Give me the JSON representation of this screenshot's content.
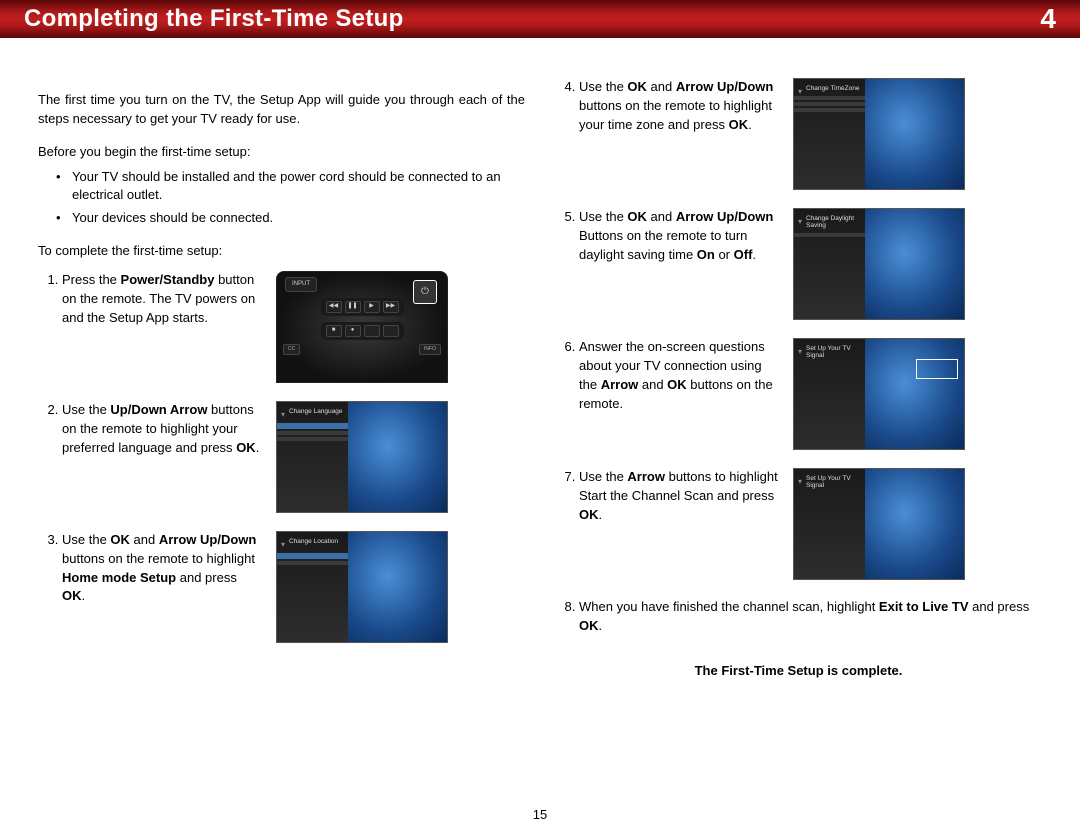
{
  "header": {
    "title": "Completing the First-Time Setup",
    "chapter": "4"
  },
  "intro": {
    "p1_a": "The first time you turn on the TV, the Setup App will guide you through each of the steps necessary to get your TV ready for use.",
    "p2": "Before you begin the first-time setup:",
    "bullet1": "Your TV should be installed and the power cord should be connected to an electrical outlet.",
    "bullet2": "Your devices should be connected.",
    "p3": "To complete the first-time setup:"
  },
  "steps_left": {
    "s1_a": "Press the ",
    "s1_b": "Power/Standby",
    "s1_c": " button on the remote. The TV powers on and the Setup App starts.",
    "s2_a": "Use the ",
    "s2_b": "Up/Down Arrow",
    "s2_c": " buttons on the remote to highlight your preferred language and press ",
    "s2_d": "OK",
    "s2_e": ".",
    "s3_a": "Use the ",
    "s3_b": "OK",
    "s3_c": " and ",
    "s3_d": "Arrow Up/Down",
    "s3_e": " buttons on the remote to highlight ",
    "s3_f": "Home mode Setup",
    "s3_g": " and press ",
    "s3_h": "OK",
    "s3_i": "."
  },
  "steps_right": {
    "s4_a": "Use the ",
    "s4_b": "OK",
    "s4_c": " and ",
    "s4_d": "Arrow Up/Down",
    "s4_e": " buttons on the remote to highlight your time zone and press ",
    "s4_f": "OK",
    "s4_g": ".",
    "s5_a": "Use the ",
    "s5_b": "OK",
    "s5_c": " and ",
    "s5_d": "Arrow Up/Down",
    "s5_e": " Buttons on the remote to turn daylight saving time ",
    "s5_f": "On",
    "s5_g": " or ",
    "s5_h": "Off",
    "s5_i": ".",
    "s6_a": "Answer the on-screen questions about your TV connection using the ",
    "s6_b": "Arrow",
    "s6_c": " and ",
    "s6_d": "OK",
    "s6_e": " buttons on the remote.",
    "s7_a": "Use the ",
    "s7_b": "Arrow",
    "s7_c": " buttons to highlight Start the Channel Scan and press ",
    "s7_d": "OK",
    "s7_e": ".",
    "s8_a": "When you have finished the channel scan, highlight ",
    "s8_b": "Exit to Live TV",
    "s8_c": " and press ",
    "s8_d": "OK",
    "s8_e": "."
  },
  "complete": "The First-Time Setup is complete.",
  "page_number": "15",
  "remote": {
    "input": "INPUT",
    "cc": "CC",
    "info": "INFO",
    "power": "⏻",
    "rew": "◀◀",
    "play": "▶",
    "pause": "❚❚",
    "ff": "▶▶"
  },
  "tv": {
    "lang_t": "Change Language",
    "loc_t": "Change Location",
    "tz_t": "Change TimeZone",
    "dst_t": "Change Daylight Saving",
    "sig_t": "Set Up Your TV Signal",
    "logo": "▾"
  }
}
